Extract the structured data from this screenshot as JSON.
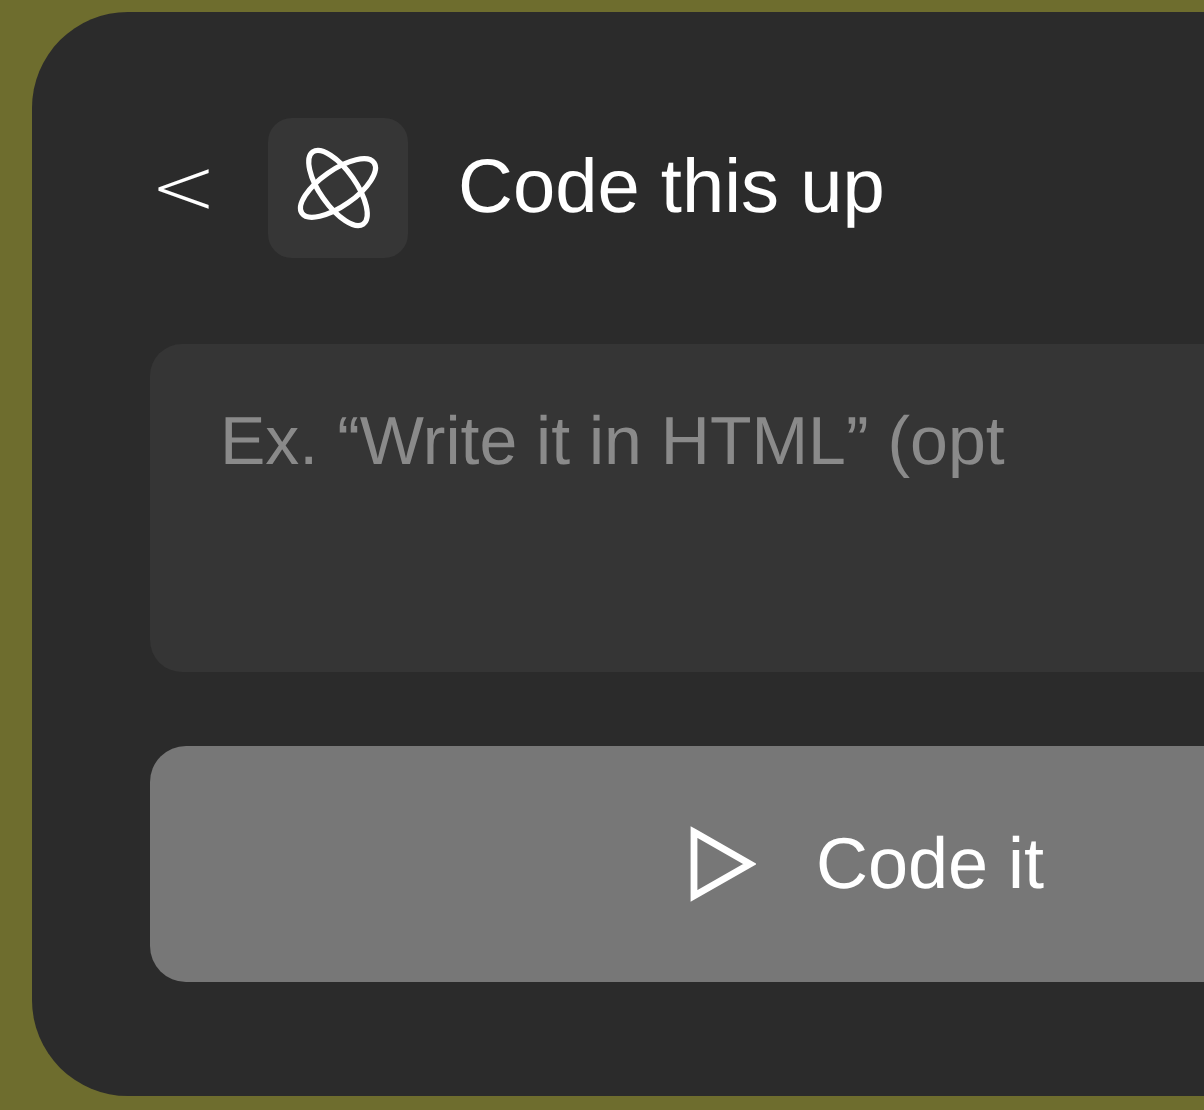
{
  "header": {
    "back": "<",
    "title": "Code this up"
  },
  "prompt": {
    "placeholder": "Ex. “Write it in HTML” (opt"
  },
  "button": {
    "label": "Code it"
  }
}
